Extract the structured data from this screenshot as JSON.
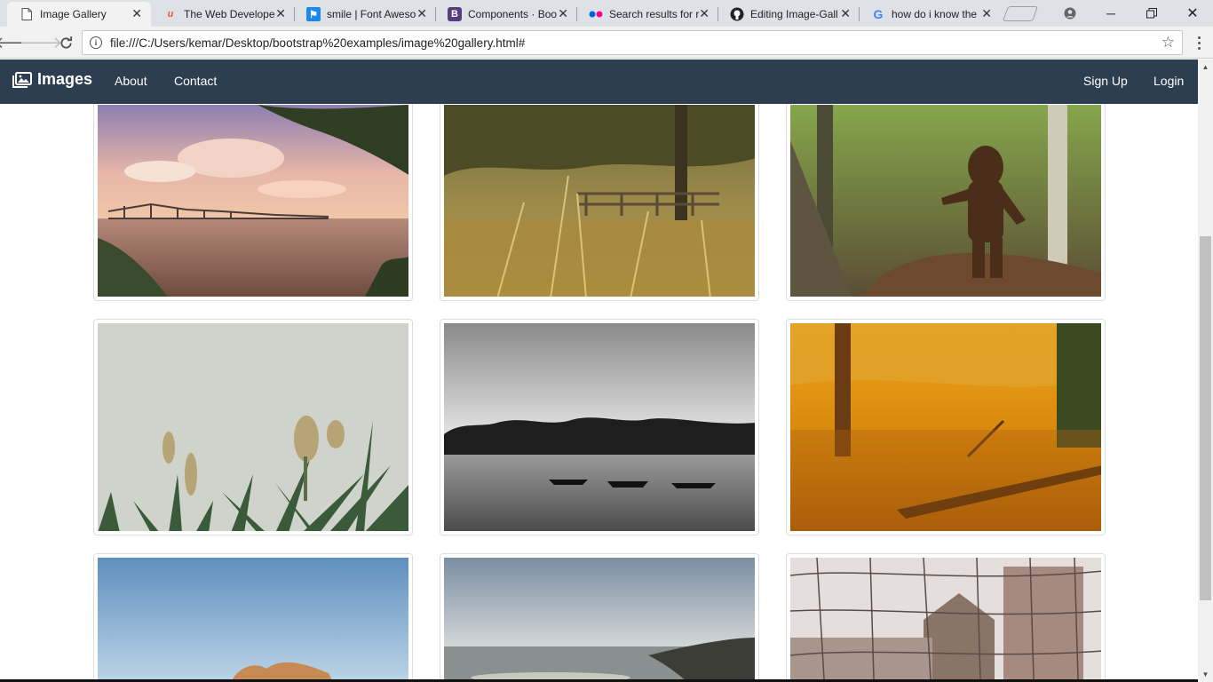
{
  "browser": {
    "tabs": [
      {
        "title": "Image Gallery",
        "favicon": "page-icon",
        "active": true
      },
      {
        "title": "The Web Develope",
        "favicon": "udemy-icon",
        "active": false
      },
      {
        "title": "smile | Font Aweso",
        "favicon": "font-awesome-flag-icon",
        "active": false
      },
      {
        "title": "Components · Boo",
        "favicon": "bootstrap-icon",
        "active": false
      },
      {
        "title": "Search results for r",
        "favicon": "flickr-icon",
        "active": false
      },
      {
        "title": "Editing Image-Gall",
        "favicon": "github-icon",
        "active": false
      },
      {
        "title": "how do i know the",
        "favicon": "google-icon",
        "active": false
      }
    ],
    "url": "file:///C:/Users/kemar/Desktop/bootstrap%20examples/image%20gallery.html#"
  },
  "navbar": {
    "brand": "Images",
    "links": [
      "About",
      "Contact"
    ],
    "right_links": [
      "Sign Up",
      "Login"
    ],
    "background": "#2c3e50"
  },
  "gallery": {
    "images": [
      {
        "subject": "river-bridge-sunset"
      },
      {
        "subject": "forest-wooden-bridge"
      },
      {
        "subject": "bigfoot-figurine-forest"
      },
      {
        "subject": "yucca-plants-sky"
      },
      {
        "subject": "black-white-lake-boats"
      },
      {
        "subject": "autumn-swamp-golden"
      },
      {
        "subject": "blue-sky-rocks"
      },
      {
        "subject": "sea-coast-cliffs"
      },
      {
        "subject": "fence-barn-ruins"
      }
    ]
  }
}
